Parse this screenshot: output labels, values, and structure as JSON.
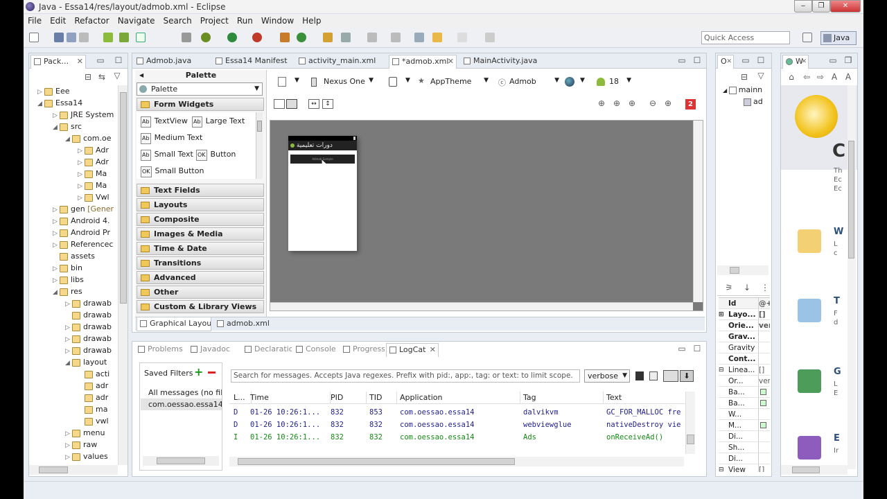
{
  "window": {
    "title": "Java - Essa14/res/layout/admob.xml - Eclipse",
    "controls": [
      "‒",
      "❐",
      "✕"
    ]
  },
  "menu": [
    "File",
    "Edit",
    "Refactor",
    "Navigate",
    "Search",
    "Project",
    "Run",
    "Window",
    "Help"
  ],
  "quick_access": {
    "placeholder": "Quick Access",
    "perspective": "Java"
  },
  "package_explorer": {
    "tab": "Pack…",
    "items": [
      {
        "label": "Eee",
        "extra": ""
      },
      {
        "label": "Essa14",
        "extra": ""
      },
      {
        "label": "JRE System",
        "extra": ""
      },
      {
        "label": "src",
        "extra": ""
      },
      {
        "label": "com.oe",
        "extra": ""
      },
      {
        "label": "Adr",
        "extra": ""
      },
      {
        "label": "Adr",
        "extra": ""
      },
      {
        "label": "Ma",
        "extra": ""
      },
      {
        "label": "Ma",
        "extra": ""
      },
      {
        "label": "Vwl",
        "extra": ""
      },
      {
        "label": "gen",
        "extra": "[Gener"
      },
      {
        "label": "Android 4.",
        "extra": ""
      },
      {
        "label": "Android Pr",
        "extra": ""
      },
      {
        "label": "Referencec",
        "extra": ""
      },
      {
        "label": "assets",
        "extra": ""
      },
      {
        "label": "bin",
        "extra": ""
      },
      {
        "label": "libs",
        "extra": ""
      },
      {
        "label": "res",
        "extra": ""
      },
      {
        "label": "drawab",
        "extra": ""
      },
      {
        "label": "drawab",
        "extra": ""
      },
      {
        "label": "drawab",
        "extra": ""
      },
      {
        "label": "drawab",
        "extra": ""
      },
      {
        "label": "drawab",
        "extra": ""
      },
      {
        "label": "layout",
        "extra": ""
      },
      {
        "label": "acti",
        "extra": ""
      },
      {
        "label": "adr",
        "extra": ""
      },
      {
        "label": "adr",
        "extra": ""
      },
      {
        "label": "ma",
        "extra": ""
      },
      {
        "label": "vwl",
        "extra": ""
      },
      {
        "label": "menu",
        "extra": ""
      },
      {
        "label": "raw",
        "extra": ""
      },
      {
        "label": "values",
        "extra": ""
      }
    ]
  },
  "editor_tabs": [
    {
      "label": "Admob.java",
      "active": false
    },
    {
      "label": "Essa14 Manifest",
      "active": false
    },
    {
      "label": "activity_main.xml",
      "active": false
    },
    {
      "label": "*admob.xml",
      "active": true
    },
    {
      "label": "MainActivity.java",
      "active": false
    }
  ],
  "palette": {
    "header": "Palette",
    "dropdown": "Palette",
    "open_category": "Form Widgets",
    "widgets": [
      {
        "badge": "Ab",
        "label": "TextView"
      },
      {
        "badge": "Ab",
        "label": "Large Text"
      },
      {
        "badge": "Ab",
        "label": "Medium Text"
      },
      {
        "badge": "Ab",
        "label": "Small Text"
      },
      {
        "badge": "OK",
        "label": "Button"
      },
      {
        "badge": "OK",
        "label": "Small Button"
      }
    ],
    "categories": [
      "Text Fields",
      "Layouts",
      "Composite",
      "Images & Media",
      "Time & Date",
      "Transitions",
      "Advanced",
      "Other",
      "Custom & Library Views"
    ]
  },
  "layout_toolbar": {
    "device": "Nexus One",
    "theme": "AppTheme",
    "activity": "Admob",
    "api": "18",
    "error_count": "2"
  },
  "device_preview": {
    "app_title": "دورات تعليمية",
    "ad_text": "Admob Sample"
  },
  "editor_bottom_tabs": [
    "Graphical Layout",
    "admob.xml"
  ],
  "bottom_tabs": [
    {
      "label": "Problems",
      "active": false
    },
    {
      "label": "Javadoc",
      "active": false
    },
    {
      "label": "Declaration",
      "active": false
    },
    {
      "label": "Console",
      "active": false
    },
    {
      "label": "Progress",
      "active": false
    },
    {
      "label": "LogCat",
      "active": true
    }
  ],
  "logcat": {
    "saved_filters_label": "Saved Filters",
    "filters": [
      "All messages (no filte",
      "com.oessao.essa14 (S"
    ],
    "search_placeholder": "Search for messages. Accepts Java regexes. Prefix with pid:, app:, tag: or text: to limit scope.",
    "level": "verbose",
    "columns": [
      "L...",
      "Time",
      "PID",
      "TID",
      "Application",
      "Tag",
      "Text"
    ],
    "rows": [
      {
        "level": "D",
        "time": "01-26 10:26:1...",
        "pid": "832",
        "tid": "853",
        "app": "com.oessao.essa14",
        "tag": "dalvikvm",
        "text": "GC_FOR_MALLOC fre",
        "color": "#1f1f8f"
      },
      {
        "level": "D",
        "time": "01-26 10:26:1...",
        "pid": "832",
        "tid": "832",
        "app": "com.oessao.essa14",
        "tag": "webviewglue",
        "text": "nativeDestroy vie",
        "color": "#1f1f8f"
      },
      {
        "level": "I",
        "time": "01-26 10:26:1...",
        "pid": "832",
        "tid": "832",
        "app": "com.oessao.essa14",
        "tag": "Ads",
        "text": "onReceiveAd()",
        "color": "#138a13"
      }
    ]
  },
  "outline": {
    "tab": "O",
    "items": [
      "mainn",
      "ad"
    ]
  },
  "properties": {
    "header_id": "Id",
    "header_val": "@+",
    "rows": [
      {
        "key": "Layo...",
        "val": "[]",
        "bold": true,
        "exp": "⊞"
      },
      {
        "key": "Orie...",
        "val": "verl",
        "bold": true,
        "exp": ""
      },
      {
        "key": "Grav...",
        "val": "",
        "bold": true,
        "exp": ""
      },
      {
        "key": "Gravity",
        "val": "",
        "bold": false,
        "exp": ""
      },
      {
        "key": "Cont...",
        "val": "",
        "bold": true,
        "exp": ""
      },
      {
        "key": "Linea...",
        "val": "[]",
        "bold": false,
        "exp": "⊟"
      },
      {
        "key": "Or...",
        "val": "verl",
        "bold": false,
        "exp": ""
      },
      {
        "key": "Ba...",
        "val": "",
        "bold": false,
        "exp": ""
      },
      {
        "key": "Ba...",
        "val": "",
        "bold": false,
        "exp": ""
      },
      {
        "key": "W...",
        "val": "",
        "bold": false,
        "exp": ""
      },
      {
        "key": "M...",
        "val": "",
        "bold": false,
        "exp": ""
      },
      {
        "key": "Di...",
        "val": "",
        "bold": false,
        "exp": ""
      },
      {
        "key": "Sh...",
        "val": "",
        "bold": false,
        "exp": ""
      },
      {
        "key": "Di...",
        "val": "",
        "bold": false,
        "exp": ""
      },
      {
        "key": "View",
        "val": "[]",
        "bold": false,
        "exp": "⊟"
      }
    ]
  },
  "welcome": {
    "tab": "W",
    "items": [
      {
        "letter": "C",
        "lines": [
          "Th",
          "Ec",
          "Ec"
        ]
      },
      {
        "letter": "W",
        "lines": [
          "L",
          "c"
        ]
      },
      {
        "letter": "T",
        "lines": [
          "F",
          "d"
        ]
      },
      {
        "letter": "G",
        "lines": [
          "L",
          "E"
        ]
      },
      {
        "letter": "E",
        "lines": [
          "Ir"
        ]
      }
    ]
  }
}
